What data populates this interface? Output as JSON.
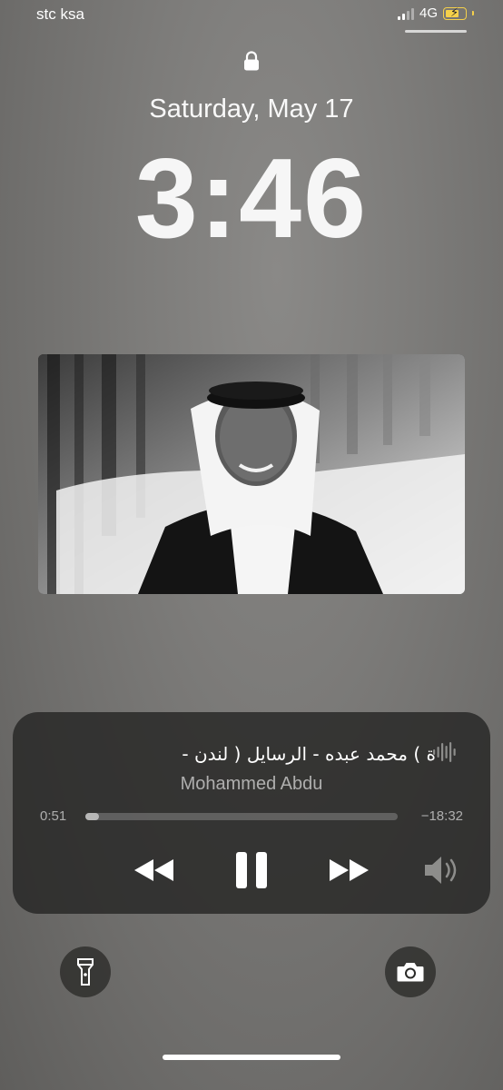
{
  "status_bar": {
    "carrier": "stc ksa",
    "network": "4G",
    "battery_color": "#f5d04b",
    "signal_bars_active": 2
  },
  "lock_screen": {
    "lock_icon": "lock-icon",
    "date": "Saturday, May 17",
    "time": "3:46"
  },
  "now_playing": {
    "artwork_icon": "album-artwork",
    "title": "ة )   محمد عبده - الرسايل ( لندن -",
    "artist": "Mohammed Abdu",
    "elapsed": "0:51",
    "remaining": "−18:32",
    "progress": 0.045,
    "controls": {
      "rewind_icon": "rewind-icon",
      "pause_icon": "pause-icon",
      "forward_icon": "fast-forward-icon",
      "volume_icon": "speaker-icon",
      "waveform_icon": "waveform-icon"
    }
  },
  "quick_actions": {
    "flashlight_icon": "flashlight-icon",
    "camera_icon": "camera-icon"
  }
}
